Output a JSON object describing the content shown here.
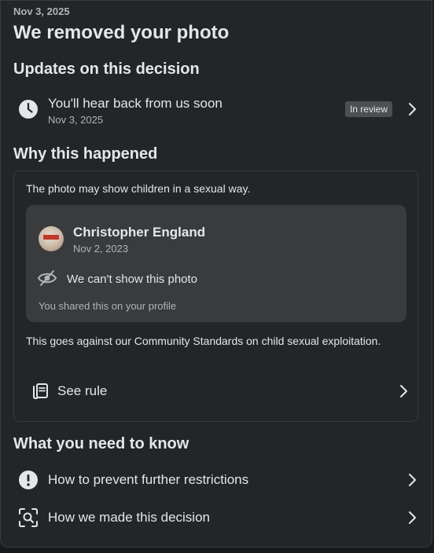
{
  "header": {
    "date": "Nov 3, 2025",
    "title": "We removed your photo"
  },
  "updates": {
    "heading": "Updates on this decision",
    "item": {
      "label": "You'll hear back from us soon",
      "date": "Nov 3, 2025",
      "status": "In review",
      "icon": "clock-icon"
    }
  },
  "why": {
    "heading": "Why this happened",
    "reason": "The photo may show children in a sexual way.",
    "post": {
      "author": "Christopher England",
      "date": "Nov 2, 2023",
      "hidden_label": "We can't show this photo",
      "shared_note": "You shared this on your profile"
    },
    "violation": "This goes against our Community Standards on child sexual exploitation.",
    "see_rule": "See rule"
  },
  "know": {
    "heading": "What you need to know",
    "items": [
      {
        "label": "How to prevent further restrictions",
        "icon": "alert-icon"
      },
      {
        "label": "How we made this decision",
        "icon": "inspect-icon"
      }
    ]
  },
  "colors": {
    "background": "#242526",
    "card_inner": "#3a3b3c",
    "text_primary": "#e4e6eb",
    "text_secondary": "#b0b3b8",
    "badge": "#4e4f50"
  }
}
